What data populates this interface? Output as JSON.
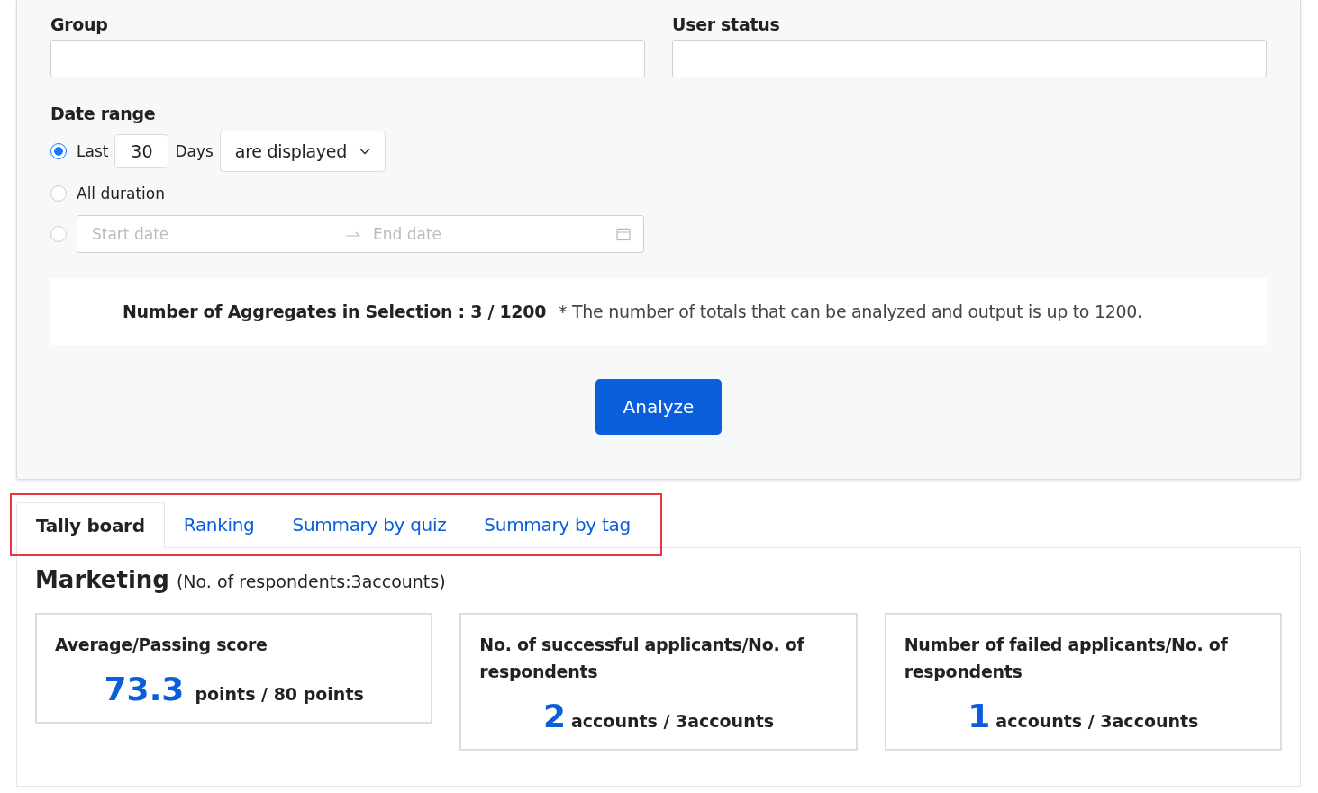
{
  "filters": [
    {
      "label": "Group"
    },
    {
      "label": "User status"
    }
  ],
  "date_range": {
    "label": "Date range",
    "options": [
      {
        "kind": "last",
        "selected": true,
        "prefix": "Last",
        "value": "30",
        "suffix": "Days",
        "dropdown": "are displayed"
      },
      {
        "kind": "all",
        "selected": false,
        "label": "All duration"
      },
      {
        "kind": "range",
        "selected": false,
        "start_placeholder": "Start date",
        "end_placeholder": "End date"
      }
    ]
  },
  "aggregate": {
    "label": "Number of Aggregates in Selection : 3 / 1200",
    "note": "* The number of totals that can be analyzed and output is up to 1200."
  },
  "analyze_button": "Analyze",
  "tabs_highlighted": true,
  "tabs": [
    {
      "label": "Tally board",
      "selected": true
    },
    {
      "label": "Ranking",
      "selected": false
    },
    {
      "label": "Summary by quiz",
      "selected": false
    },
    {
      "label": "Summary by tag",
      "selected": false
    }
  ],
  "section": {
    "title": "Marketing",
    "subtitle": "(No. of respondents:3accounts)"
  },
  "cards": [
    {
      "title": "Average/Passing score",
      "value": "73.3",
      "unit": "points / 80 points"
    },
    {
      "title": "No. of successful applicants/No. of respondents",
      "value": "2",
      "unit": "accounts / 3accounts"
    },
    {
      "title": "Number of failed applicants/No. of respondents",
      "value": "1",
      "unit": "accounts / 3accounts"
    }
  ]
}
